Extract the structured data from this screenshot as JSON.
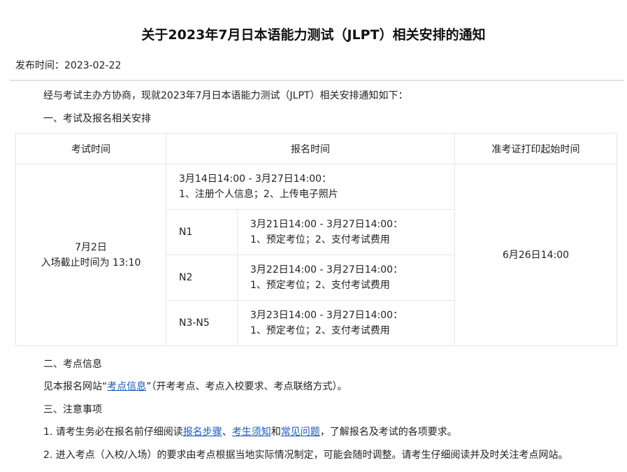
{
  "title": "关于2023年7月日本语能力测试（JLPT）相关安排的通知",
  "publish": {
    "label": "发布时间：",
    "date": "2023-02-22"
  },
  "intro": "经与考试主办方协商，现就2023年7月日本语能力测试（JLPT）相关安排通知如下：",
  "section1_title": "一、考试及报名相关安排",
  "table": {
    "headers": [
      "考试时间",
      "报名时间",
      "准考证打印起始时间"
    ],
    "exam_date": "7月2日",
    "exam_cutoff": "入场截止时间为 13:10",
    "first_reg_time": "3月14日14:00 - 3月27日14:00：",
    "first_reg_desc": "1、注册个人信息；2、上传电子照片",
    "levels": [
      {
        "level": "N1",
        "time": "3月21日14:00 - 3月27日14:00：",
        "desc": "1、预定考位；2、支付考试费用"
      },
      {
        "level": "N2",
        "time": "3月22日14:00 - 3月27日14:00：",
        "desc": "1、预定考位；2、支付考试费用"
      },
      {
        "level": "N3-N5",
        "time": "3月23日14:00 - 3月27日14:00：",
        "desc": "1、预定考位；2、支付考试费用"
      }
    ],
    "print_start": "6月26日14:00"
  },
  "section2": {
    "title": "二、考点信息",
    "prefix": "见本报名网站“",
    "link": "考点信息",
    "suffix": "”（开考考点、考点入校要求、考点联络方式）。"
  },
  "section3": {
    "title": "三、注意事项",
    "note1": {
      "prefix": "1. 请考生务必在报名前仔细阅读",
      "link1": "报名步骤",
      "sep1": "、",
      "link2": "考生须知",
      "sep2": "和",
      "link3": "常见问题",
      "suffix": "，了解报名及考试的各项要求。"
    },
    "note2": "2. 进入考点（入校/入场）的要求由考点根据当地实际情况制定，可能会随时调整。请考生仔细阅读并及时关注考点网站。"
  },
  "colors": {
    "link": "#1a5bb8",
    "border": "#e6e6e6",
    "divider": "#e3e3e3"
  }
}
